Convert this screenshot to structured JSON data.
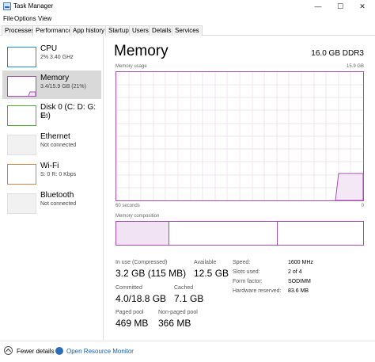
{
  "window": {
    "title": "Task Manager",
    "minimize": "—",
    "maximize": "☐",
    "close": "✕"
  },
  "menu": [
    "File",
    "Options",
    "View"
  ],
  "tabs": [
    "Processes",
    "Performance",
    "App history",
    "Startup",
    "Users",
    "Details",
    "Services"
  ],
  "colors": {
    "cpu": "#1a8fd6",
    "memory": "#a64db3",
    "disk": "#4eb030",
    "ethernet": "#a05c00",
    "wifi": "#a05c00"
  },
  "sidebar": [
    {
      "name": "CPU",
      "sub": "2% 3.40 GHz"
    },
    {
      "name": "Memory",
      "sub": "3.4/15.9 GB (21%)"
    },
    {
      "name": "Disk 0 (C: D: G: E:)",
      "sub": "1%"
    },
    {
      "name": "Ethernet",
      "sub": "Not connected"
    },
    {
      "name": "Wi-Fi",
      "sub": "S: 0 R: 0 Kbps"
    },
    {
      "name": "Bluetooth",
      "sub": "Not connected"
    }
  ],
  "main": {
    "title": "Memory",
    "spec": "16.0 GB DDR3",
    "graph_label": "Memory usage",
    "graph_max": "15.9 GB",
    "graph_xleft": "60 seconds",
    "graph_xright": "0",
    "composition_label": "Memory composition",
    "stats": {
      "in_use_label": "In use (Compressed)",
      "in_use": "3.2 GB (115 MB)",
      "available_label": "Available",
      "available": "12.5 GB",
      "committed_label": "Committed",
      "committed": "4.0/18.8 GB",
      "cached_label": "Cached",
      "cached": "7.1 GB",
      "paged_label": "Paged pool",
      "paged": "469 MB",
      "nonpaged_label": "Non-paged pool",
      "nonpaged": "366 MB"
    },
    "details": {
      "speed_label": "Speed:",
      "speed": "1600 MHz",
      "slots_label": "Slots used:",
      "slots": "2 of 4",
      "form_label": "Form factor:",
      "form": "SODIMM",
      "reserved_label": "Hardware reserved:",
      "reserved": "83.6 MB"
    }
  },
  "footer": {
    "fewer": "Fewer details",
    "monitor": "Open Resource Monitor"
  }
}
